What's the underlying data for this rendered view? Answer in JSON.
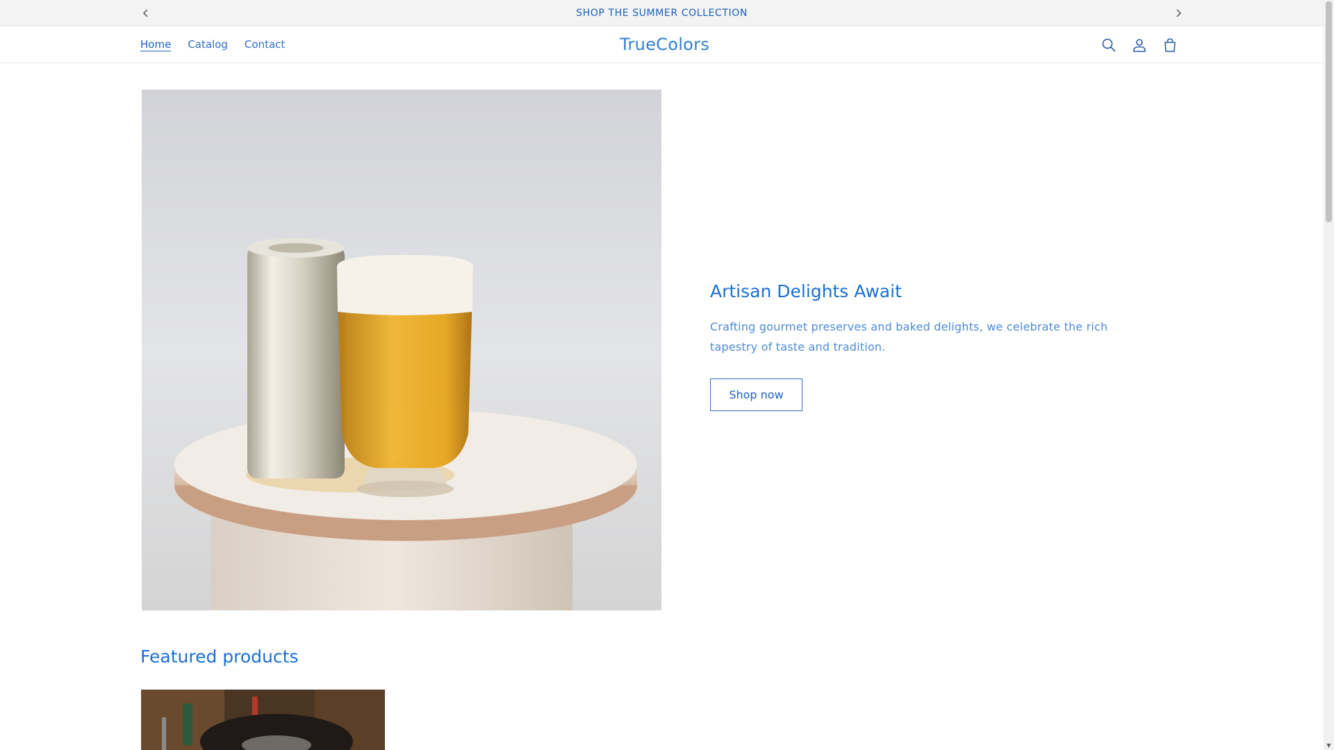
{
  "announcement": {
    "text": "SHOP THE SUMMER COLLECTION",
    "prev_icon": "chevron-left-icon",
    "next_icon": "chevron-right-icon"
  },
  "header": {
    "brand": "TrueColors",
    "nav": [
      {
        "label": "Home",
        "active": true
      },
      {
        "label": "Catalog",
        "active": false
      },
      {
        "label": "Contact",
        "active": false
      }
    ],
    "icons": [
      "search-icon",
      "account-icon",
      "cart-icon"
    ]
  },
  "hero": {
    "title": "Artisan Delights Await",
    "description": "Crafting gourmet preserves and baked delights, we celebrate the rich tapestry of taste and tradition.",
    "button_label": "Shop now"
  },
  "featured": {
    "title": "Featured products"
  },
  "colors": {
    "accent": "#1a6fd0",
    "announcement_bg": "#f3f3f3"
  }
}
